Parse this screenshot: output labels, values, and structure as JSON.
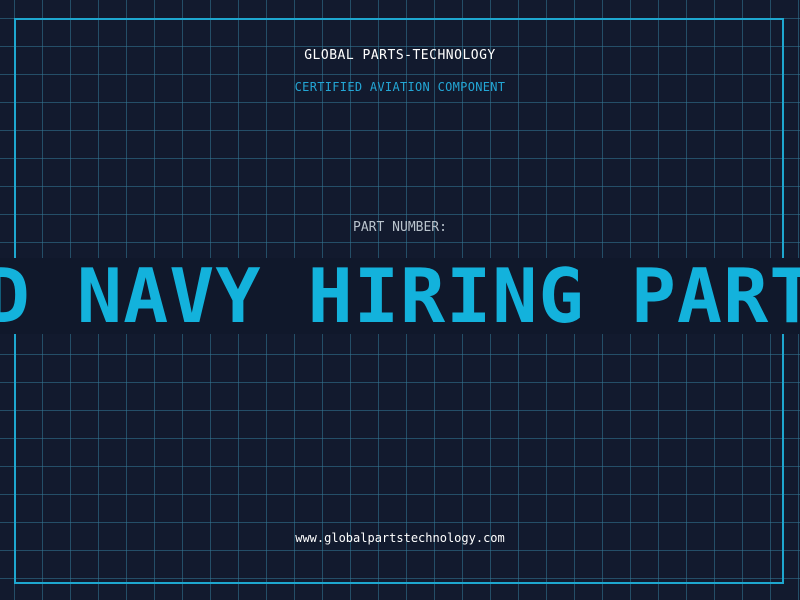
{
  "brand": {
    "name": "GLOBAL PARTS-TECHNOLOGY",
    "tagline": "CERTIFIED AVIATION COMPONENT"
  },
  "part": {
    "label": "PART NUMBER:",
    "value": "D NAVY HIRING PART"
  },
  "footer": {
    "url": "www.globalpartstechnology.com"
  },
  "colors": {
    "background": "#121a2e",
    "accent": "#13b2dc",
    "grid": "#2e6a86"
  }
}
